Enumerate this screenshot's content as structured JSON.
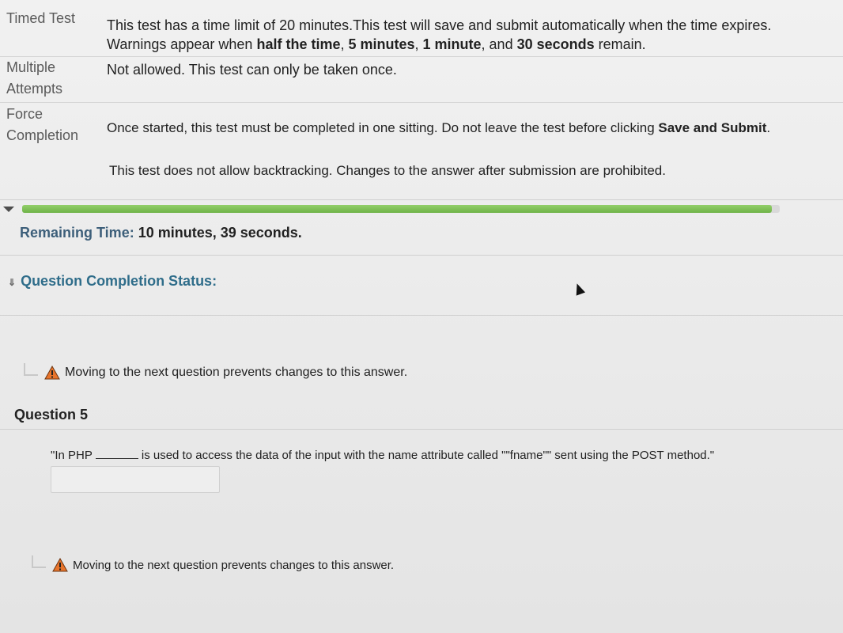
{
  "test_info": {
    "timed_test": {
      "label": "Timed Test",
      "line1": "This test has a time limit of 20 minutes.This test will save and submit automatically when the time expires.",
      "line2_pre": "Warnings appear when ",
      "line2_b1": "half the time",
      "line2_sep1": ", ",
      "line2_b2": "5 minutes",
      "line2_sep2": ", ",
      "line2_b3": "1 minute",
      "line2_sep3": ", and ",
      "line2_b4": "30 seconds",
      "line2_post": " remain."
    },
    "multiple_attempts": {
      "label_line1": "Multiple",
      "label_line2": "Attempts",
      "value": "Not allowed. This test can only be taken once."
    },
    "force_completion": {
      "label_line1": "Force",
      "label_line2": "Completion",
      "value_pre": "Once started, this test must be completed in one sitting. Do not leave the test before clicking ",
      "value_b": "Save and Submit",
      "value_post": "."
    },
    "backtracking": "This test does not allow backtracking. Changes to the answer after submission are prohibited."
  },
  "timer": {
    "progress_fraction": 0.99,
    "remaining_label": "Remaining Time:",
    "remaining_value": "10 minutes, 39 seconds."
  },
  "completion_status": {
    "label": "Question Completion Status:"
  },
  "warning_text": "Moving to the next question prevents changes to this answer.",
  "question": {
    "title": "Question 5",
    "text_pre": "\"In PHP",
    "text_post": "is used to access the data of the input with the name attribute called \"\"fname\"\" sent using the POST method.\"",
    "answer_value": ""
  },
  "icons": {
    "warning": "warning-triangle-icon",
    "collapse": "caret-down-icon",
    "expand": "double-chevron-icon",
    "hook": "arrow-hook-icon"
  },
  "colors": {
    "progress_green": "#7dbf52",
    "label_blue": "#2f6d8a",
    "warning_orange": "#e8742b"
  }
}
